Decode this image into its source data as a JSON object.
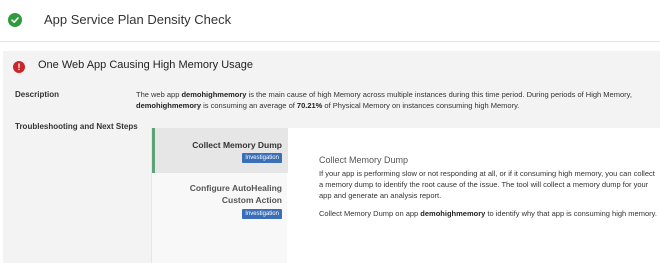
{
  "header": {
    "title": "App Service Plan Density Check",
    "status_icon": "check-circle-icon",
    "status_color": "#2e9b3f"
  },
  "panel": {
    "title": "One Web App Causing High Memory Usage",
    "severity_icon": "error-icon",
    "severity_color": "#c8262a",
    "description_label": "Description",
    "description": {
      "t1": "The web app ",
      "app": "demohighmemory",
      "t2": " is the main cause of high Memory across multiple instances during this time period. During periods of High Memory,",
      "app2": "demohighmemory",
      "t3": " is consuming an average of ",
      "pct": "70.21%",
      "t4": " of Physical Memory on instances consuming high Memory."
    },
    "steps_label": "Troubleshooting and Next Steps",
    "steps": [
      {
        "name": "Collect Memory Dump",
        "badge": "Investigation",
        "selected": true
      },
      {
        "name": "Configure AutoHealing Custom Action",
        "badge": "Investigation",
        "selected": false
      }
    ],
    "detail": {
      "title": "Collect Memory Dump",
      "p1": "If your app is performing slow or not responding at all, or if it consuming high memory, you can collect a memory dump to identify the root cause of the issue. The tool will collect a memory dump for your app and generate an analysis report.",
      "p2_a": "Collect Memory Dump on app ",
      "p2_app": "demohighmemory",
      "p2_b": " to identify why that app is consuming high memory."
    }
  }
}
